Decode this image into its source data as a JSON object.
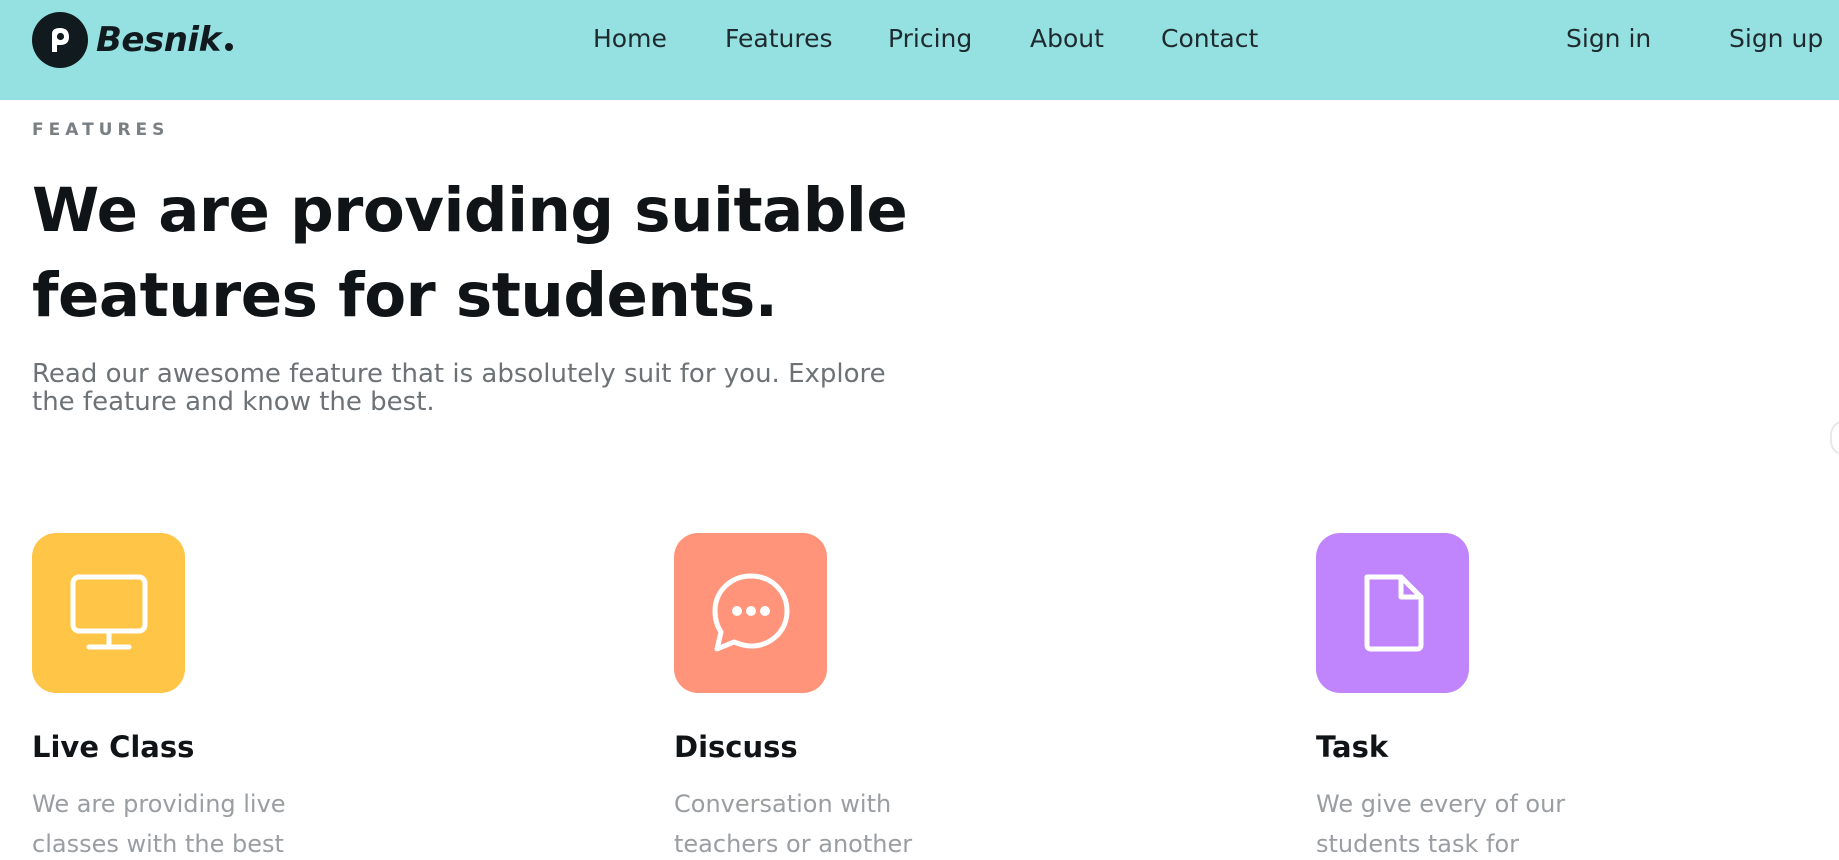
{
  "brand": {
    "name": "Besnik",
    "icon": "besnik-logo-icon"
  },
  "nav": {
    "links": [
      "Home",
      "Features",
      "Pricing",
      "About",
      "Contact"
    ],
    "sign_in": "Sign in",
    "sign_up": "Sign up"
  },
  "hero": {
    "eyebrow": "FEATURES",
    "headline_line1": "We are providing suitable",
    "headline_line2": "features for students.",
    "subtext": "Read our awesome feature that is absolutely suit for you. Explore the feature and know the best."
  },
  "features": [
    {
      "title": "Live Class",
      "description": "We are providing live classes with the best",
      "icon": "monitor-icon",
      "color": "#ffc547"
    },
    {
      "title": "Discuss",
      "description": "Conversation with teachers or another",
      "icon": "chat-bubble-icon",
      "color": "#ff947b"
    },
    {
      "title": "Task",
      "description": "We give every of our students task for",
      "icon": "document-icon",
      "color": "#c084fc"
    }
  ],
  "colors": {
    "header_bg": "#95e0e1",
    "text_dark": "#111417",
    "text_muted": "#9a9ea2"
  }
}
